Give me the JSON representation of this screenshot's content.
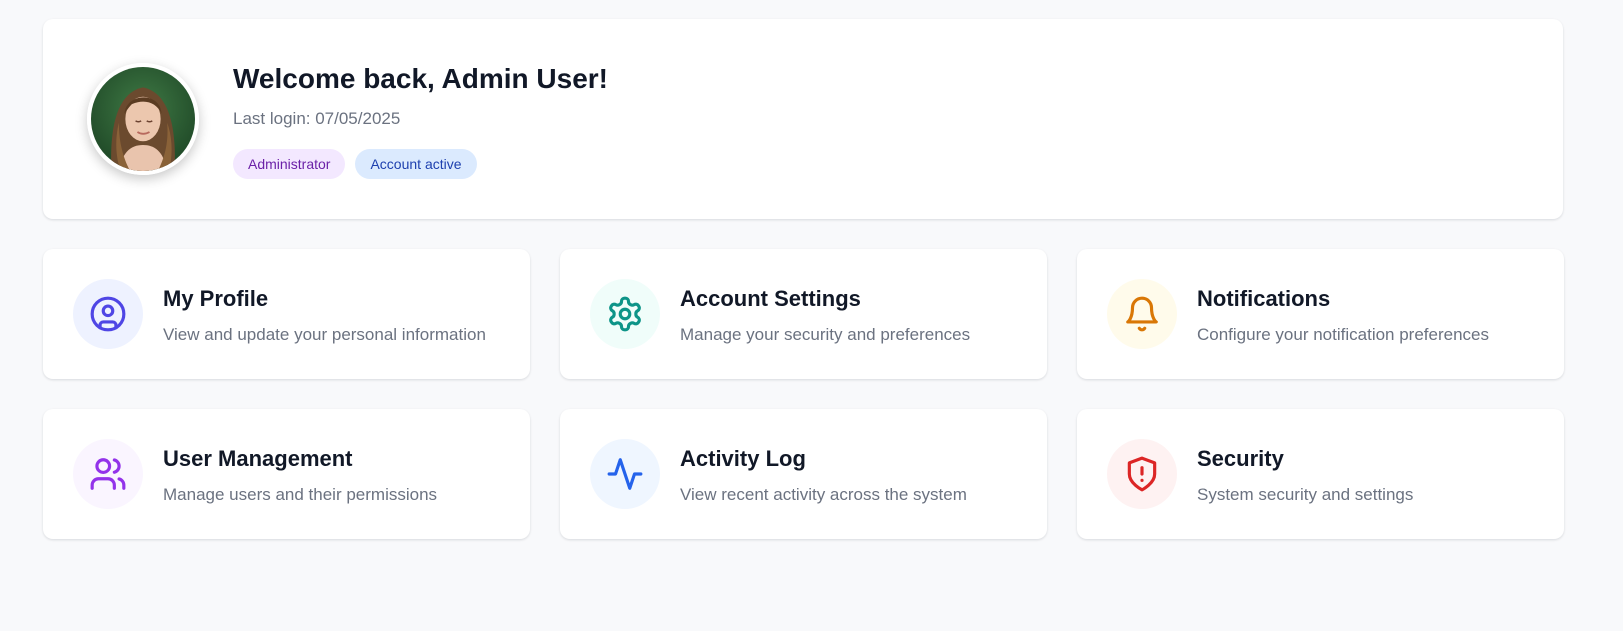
{
  "welcome": {
    "title": "Welcome back, Admin User!",
    "last_login": "Last login: 07/05/2025",
    "badges": [
      {
        "label": "Administrator"
      },
      {
        "label": "Account active"
      }
    ]
  },
  "cards": [
    {
      "title": "My Profile",
      "description": "View and update your personal information",
      "icon": "user-circle-icon",
      "color": "#4f46e5",
      "bg": "#eef2ff"
    },
    {
      "title": "Account Settings",
      "description": "Manage your security and preferences",
      "icon": "gear-icon",
      "color": "#0d9488",
      "bg": "#f0fdfa"
    },
    {
      "title": "Notifications",
      "description": "Configure your notification preferences",
      "icon": "bell-icon",
      "color": "#d97706",
      "bg": "#fffbeb"
    },
    {
      "title": "User Management",
      "description": "Manage users and their permissions",
      "icon": "users-icon",
      "color": "#9333ea",
      "bg": "#faf5ff"
    },
    {
      "title": "Activity Log",
      "description": "View recent activity across the system",
      "icon": "activity-icon",
      "color": "#2563eb",
      "bg": "#eff6ff"
    },
    {
      "title": "Security",
      "description": "System security and settings",
      "icon": "shield-alert-icon",
      "color": "#dc2626",
      "bg": "#fef2f2"
    }
  ]
}
